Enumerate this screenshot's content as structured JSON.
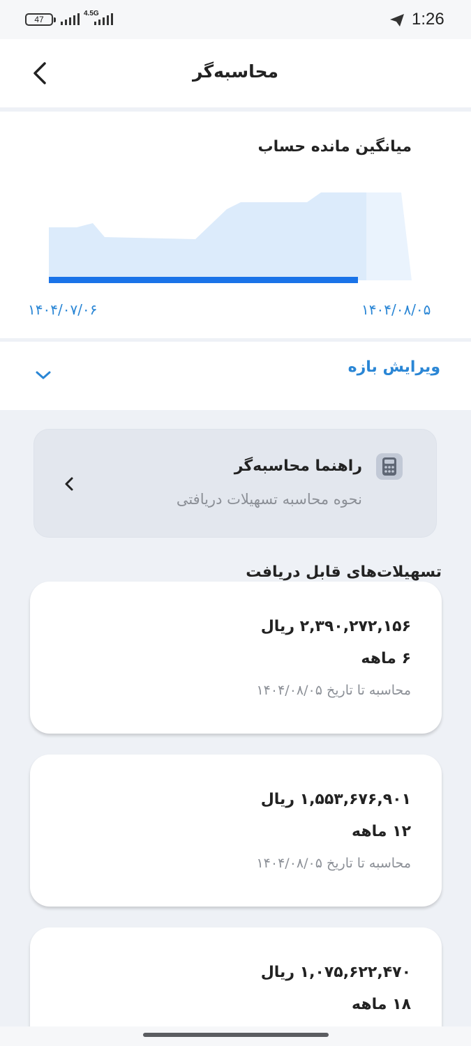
{
  "status_bar": {
    "battery": "47",
    "network": "4.5G",
    "time": "1:26",
    "icons": [
      "battery-icon",
      "signal-icon",
      "telegram-send-icon"
    ]
  },
  "header": {
    "title": "محاسبه‌گر",
    "back_icon": "chevron-left-icon"
  },
  "chart": {
    "title": "میانگین مانده حساب",
    "start_date": "۱۴۰۴/۰۷/۰۶",
    "end_date": "۱۴۰۴/۰۸/۰۵",
    "colors": {
      "area": "#dcebfb",
      "area_light": "#eaf3fd",
      "progress": "#1a73e8",
      "date_text": "#2a86d5"
    }
  },
  "range": {
    "label": "ویرایش بازه",
    "icon": "chevron-down-icon"
  },
  "guide": {
    "title": "راهنما محاسبه‌گر",
    "subtitle": "نحوه محاسبه تسهیلات دریافتی",
    "icon": "calculator-icon",
    "chevron_icon": "chevron-left-icon"
  },
  "facilities": {
    "title": "تسهیلات‌های قابل دریافت",
    "items": [
      {
        "amount": "۲,۳۹۰,۲۷۲,۱۵۶ ریال",
        "duration": "۶ ماهه",
        "note": "محاسبه تا تاریخ ۱۴۰۴/۰۸/۰۵"
      },
      {
        "amount": "۱,۵۵۳,۶۷۶,۹۰۱ ریال",
        "duration": "۱۲ ماهه",
        "note": "محاسبه تا تاریخ ۱۴۰۴/۰۸/۰۵"
      },
      {
        "amount": "۱,۰۷۵,۶۲۲,۴۷۰ ریال",
        "duration": "۱۸ ماهه"
      }
    ]
  }
}
